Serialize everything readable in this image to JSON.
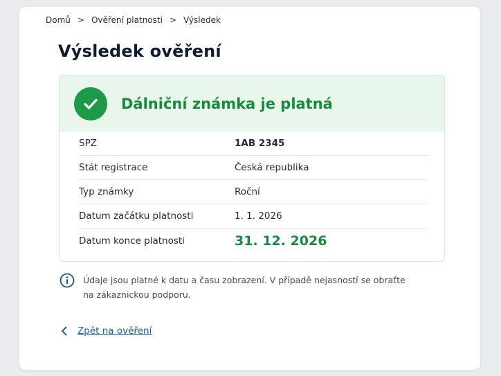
{
  "breadcrumb": {
    "items": [
      "Domů",
      "Ověření platnosti",
      "Výsledek"
    ],
    "separator": ">"
  },
  "page": {
    "title": "Výsledek ověření"
  },
  "result": {
    "status_icon": "check-icon",
    "status_color": "#1d9a47",
    "status_text": "Dálniční známka je platná",
    "rows": [
      {
        "label": "SPZ",
        "value": "1AB 2345"
      },
      {
        "label": "Stát registrace",
        "value": "Česká republika"
      },
      {
        "label": "Typ známky",
        "value": "Roční"
      },
      {
        "label": "Datum začátku platnosti",
        "value": "1. 1. 2026"
      },
      {
        "label": "Datum konce platnosti",
        "value": "31. 12. 2026"
      }
    ]
  },
  "info": {
    "icon": "info-icon",
    "text": "Údaje jsou platné k datu a času zobrazení. V případě nejasností se obraťte na zákaznickou podporu."
  },
  "back": {
    "icon": "chevron-left-icon",
    "label": "Zpět na ověření"
  }
}
